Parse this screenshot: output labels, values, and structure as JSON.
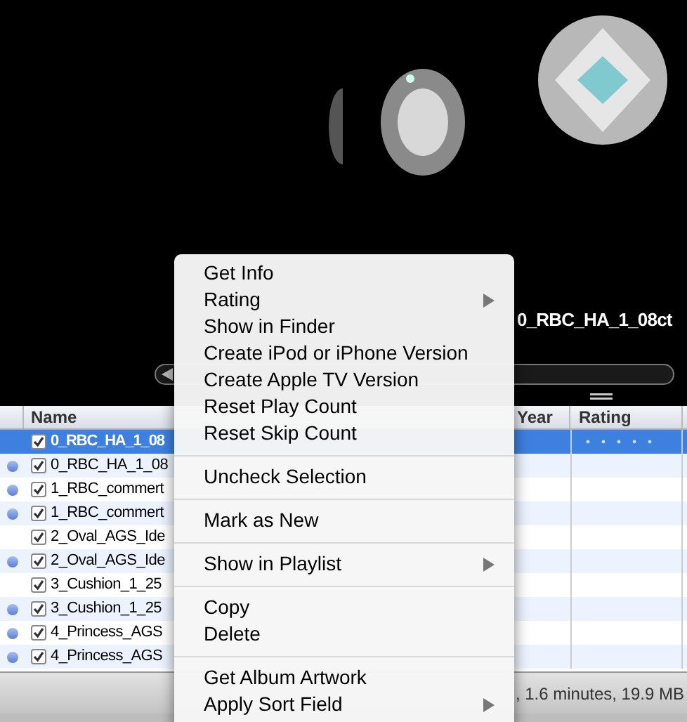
{
  "cover_flow": {
    "title": "0_RBC_HA_1_08ct"
  },
  "table": {
    "columns": [
      {
        "label": "Name"
      },
      {
        "label": "Year"
      },
      {
        "label": "Rating"
      }
    ],
    "rows": [
      {
        "name": "0_RBC_HA_1_08",
        "checked": true,
        "unplayed": false,
        "selected": true
      },
      {
        "name": "0_RBC_HA_1_08",
        "checked": true,
        "unplayed": true,
        "selected": false
      },
      {
        "name": "1_RBC_commert",
        "checked": true,
        "unplayed": true,
        "selected": false
      },
      {
        "name": "1_RBC_commert",
        "checked": true,
        "unplayed": true,
        "selected": false
      },
      {
        "name": "2_Oval_AGS_Ide",
        "checked": true,
        "unplayed": false,
        "selected": false
      },
      {
        "name": "2_Oval_AGS_Ide",
        "checked": true,
        "unplayed": true,
        "selected": false
      },
      {
        "name": "3_Cushion_1_25",
        "checked": true,
        "unplayed": false,
        "selected": false
      },
      {
        "name": "3_Cushion_1_25",
        "checked": true,
        "unplayed": true,
        "selected": false
      },
      {
        "name": "4_Princess_AGS",
        "checked": true,
        "unplayed": true,
        "selected": false
      },
      {
        "name": "4_Princess_AGS",
        "checked": true,
        "unplayed": true,
        "selected": false
      }
    ]
  },
  "status_bar": {
    "text": ", 1.6 minutes, 19.9 MB"
  },
  "context_menu": {
    "items": [
      {
        "kind": "item",
        "label": "Get Info",
        "submenu": false
      },
      {
        "kind": "item",
        "label": "Rating",
        "submenu": true
      },
      {
        "kind": "item",
        "label": "Show in Finder",
        "submenu": false
      },
      {
        "kind": "item",
        "label": "Create iPod or iPhone Version",
        "submenu": false
      },
      {
        "kind": "item",
        "label": "Create Apple TV Version",
        "submenu": false
      },
      {
        "kind": "item",
        "label": "Reset Play Count",
        "submenu": false
      },
      {
        "kind": "item",
        "label": "Reset Skip Count",
        "submenu": false
      },
      {
        "kind": "separator"
      },
      {
        "kind": "item",
        "label": "Uncheck Selection",
        "submenu": false
      },
      {
        "kind": "separator"
      },
      {
        "kind": "item",
        "label": "Mark as New",
        "submenu": false
      },
      {
        "kind": "separator"
      },
      {
        "kind": "item",
        "label": "Show in Playlist",
        "submenu": true
      },
      {
        "kind": "separator"
      },
      {
        "kind": "item",
        "label": "Copy",
        "submenu": false
      },
      {
        "kind": "item",
        "label": "Delete",
        "submenu": false
      },
      {
        "kind": "separator"
      },
      {
        "kind": "item",
        "label": "Get Album Artwork",
        "submenu": false
      },
      {
        "kind": "item",
        "label": "Apply Sort Field",
        "submenu": true
      }
    ]
  }
}
